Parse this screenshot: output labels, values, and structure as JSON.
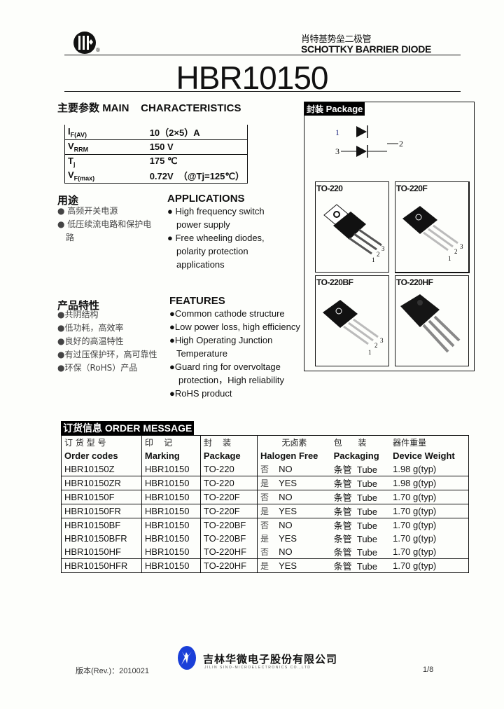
{
  "header": {
    "logo_icon": "company-logo-icon",
    "registered_mark": "®",
    "title_cn": "肖特基势垒二极管",
    "title_en": "SCHOTTKY BARRIER DIODE",
    "part_number": "HBR10150"
  },
  "main_characteristics": {
    "heading_cn": "主要参数",
    "heading_en": "MAIN    CHARACTERISTICS",
    "rows": [
      {
        "symbol": "I",
        "sub": "F(AV)",
        "value": "10（2×5）A"
      },
      {
        "symbol": "V",
        "sub": "RRM",
        "value": "150 V"
      },
      {
        "symbol": "T",
        "sub": "j",
        "value": "175 ℃"
      },
      {
        "symbol": "V",
        "sub": "F(max)",
        "value": "0.72V  （@Tj=125℃）"
      }
    ]
  },
  "applications": {
    "heading_cn": "用途",
    "heading_en": "APPLICATIONS",
    "items_cn": [
      "高频开关电源",
      "低压续流电路和保护电",
      "路"
    ],
    "items_en": [
      "High frequency switch",
      "power supply",
      "Free wheeling diodes,",
      "polarity protection",
      "applications"
    ]
  },
  "features": {
    "heading_cn": "产品特性",
    "heading_en": "FEATURES",
    "items_cn": [
      "共阴结构",
      "低功耗，高效率",
      "良好的高温特性",
      "有过压保护环，高可靠性",
      "环保（RoHS）产品"
    ],
    "items_en": [
      "Common cathode structure",
      "Low power loss, high efficiency",
      "High Operating Junction",
      "Temperature",
      "Guard ring for overvoltage",
      "protection，High reliability",
      "RoHS product"
    ]
  },
  "package": {
    "heading_cn": "封装",
    "heading_en": "Package",
    "pin_labels": [
      "1",
      "2",
      "3"
    ],
    "types": [
      "TO-220",
      "TO-220F",
      "TO-220BF",
      "TO-220HF"
    ]
  },
  "order": {
    "heading_cn": "订货信息",
    "heading_en": "ORDER MESSAGE",
    "columns_cn": [
      "订 货 型 号",
      "印    记",
      "封    装",
      "无卤素",
      "包      装",
      "器件重量"
    ],
    "columns_en": [
      "Order codes",
      "Marking",
      "Package",
      "Halogen Free",
      "Packaging",
      "Device Weight"
    ],
    "rows": [
      {
        "code": "HBR10150Z",
        "marking": "HBR10150",
        "package": "TO-220",
        "hf_cn": "否",
        "hf": "NO",
        "pack": "条管  Tube",
        "weight": "1.98 g(typ)"
      },
      {
        "code": "HBR10150ZR",
        "marking": "HBR10150",
        "package": "TO-220",
        "hf_cn": "是",
        "hf": "YES",
        "pack": "条管  Tube",
        "weight": "1.98 g(typ)"
      },
      {
        "code": "HBR10150F",
        "marking": "HBR10150",
        "package": "TO-220F",
        "hf_cn": "否",
        "hf": "NO",
        "pack": "条管  Tube",
        "weight": "1.70 g(typ)"
      },
      {
        "code": "HBR10150FR",
        "marking": "HBR10150",
        "package": "TO-220F",
        "hf_cn": "是",
        "hf": "YES",
        "pack": "条管  Tube",
        "weight": "1.70 g(typ)"
      },
      {
        "code": "HBR10150BF",
        "marking": "HBR10150",
        "package": "TO-220BF",
        "hf_cn": "否",
        "hf": "NO",
        "pack": "条管  Tube",
        "weight": "1.70 g(typ)"
      },
      {
        "code": "HBR10150BFR",
        "marking": "HBR10150",
        "package": "TO-220BF",
        "hf_cn": "是",
        "hf": "YES",
        "pack": "条管  Tube",
        "weight": "1.70 g(typ)"
      },
      {
        "code": "HBR10150HF",
        "marking": "HBR10150",
        "package": "TO-220HF",
        "hf_cn": "否",
        "hf": "NO",
        "pack": "条管  Tube",
        "weight": "1.70 g(typ)"
      },
      {
        "code": "HBR10150HFR",
        "marking": "HBR10150",
        "package": "TO-220HF",
        "hf_cn": "是",
        "hf": "YES",
        "pack": "条管  Tube",
        "weight": "1.70 g(typ)"
      }
    ]
  },
  "footer": {
    "revision": "版本(Rev.)：2010021",
    "company_cn": "吉林华微电子股份有限公司",
    "company_en": "JILIN  SINO-MICROELECTRONICS  CO.,LTD",
    "page": "1/8",
    "logo_color": "#1a3fd8"
  }
}
